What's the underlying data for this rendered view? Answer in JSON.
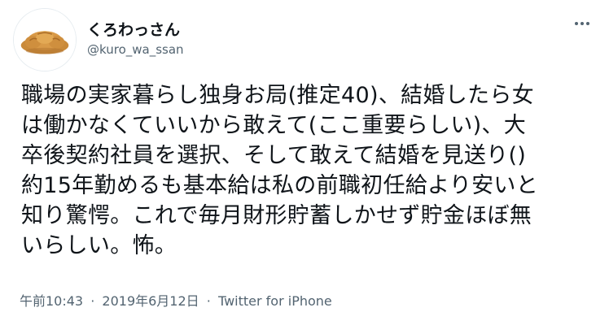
{
  "author": {
    "display_name": "くろわっさん",
    "handle": "@kuro_wa_ssan",
    "avatar_icon": "croissant-icon"
  },
  "more_icon": "more-horizontal-icon",
  "tweet": {
    "lines": [
      "職場の実家暮らし独身お局(推定40)、結婚したら女",
      "は働かなくていいから敢えて(ここ重要らしい)、大",
      "卒後契約社員を選択、そして敢えて結婚を見送り()",
      "約15年勤めるも基本給は私の前職初任給より安いと",
      "知り驚愕。これで毎月財形貯蓄しかせず貯金ほぼ無",
      "いらしい。怖。"
    ]
  },
  "meta": {
    "time": "午前10:43",
    "separator1": "·",
    "date": "2019年6月12日",
    "separator2": "·",
    "source": "Twitter for iPhone"
  },
  "colors": {
    "text": "#0f1419",
    "secondary": "#536471",
    "background": "#ffffff"
  }
}
